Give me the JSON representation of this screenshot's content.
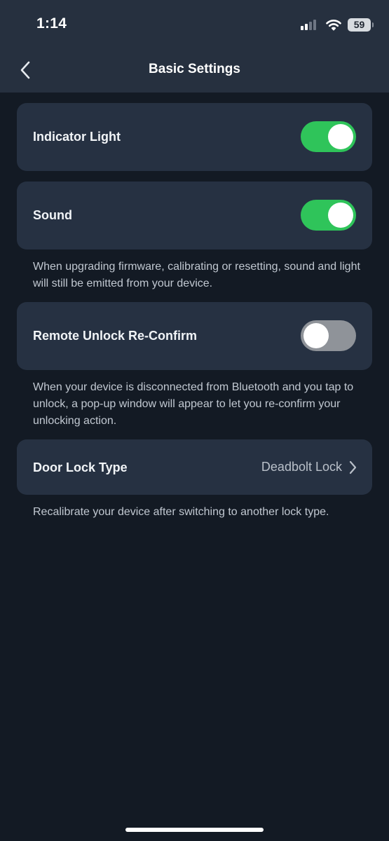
{
  "status_bar": {
    "time": "1:14",
    "battery": "59",
    "icons": [
      "signal-icon",
      "wifi-icon",
      "battery-icon"
    ]
  },
  "header": {
    "title": "Basic Settings",
    "back_icon": "chevron-left-icon"
  },
  "settings": {
    "indicator_light": {
      "label": "Indicator Light",
      "enabled": true
    },
    "sound": {
      "label": "Sound",
      "enabled": true
    },
    "sound_note": "When upgrading firmware, calibrating or resetting, sound and light will still be emitted from your device.",
    "remote_unlock": {
      "label": "Remote Unlock Re-Confirm",
      "enabled": false
    },
    "remote_unlock_note": "When your device is disconnected from Bluetooth and you tap to unlock, a pop-up window will appear to let you re-confirm your unlocking action.",
    "door_lock_type": {
      "label": "Door Lock Type",
      "value": "Deadbolt Lock",
      "icon": "chevron-right-icon"
    },
    "door_lock_note": "Recalibrate your device after switching to another lock type."
  },
  "colors": {
    "background": "#131a24",
    "header": "#26303f",
    "card": "#263142",
    "toggle_on": "#2fc45a",
    "toggle_off": "#8f9399",
    "note_text": "#c1c8d1"
  }
}
